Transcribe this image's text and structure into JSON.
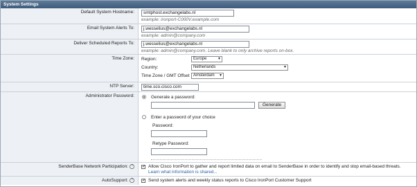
{
  "panel": {
    "title": "System Settings"
  },
  "hostname": {
    "label": "Default System Hostname:",
    "value": "smtphost.exchangelabs.nl",
    "hint": "example: ironport-C000V.example.com"
  },
  "alerts": {
    "label": "Email System Alerts To:",
    "value": "j.wesselius@exchangelabs.nl",
    "hint": "example: admin@company.com"
  },
  "reports": {
    "label": "Deliver Scheduled Reports To:",
    "value": "j.wesselius@exchangelabs.nl",
    "hint": "example: admin@company.com. Leave blank to only archive reports on-box."
  },
  "timezone": {
    "label": "Time Zone:",
    "region_label": "Region:",
    "region_value": "Europe",
    "country_label": "Country:",
    "country_value": "Netherlands",
    "offset_label": "Time Zone / GMT Offset",
    "offset_value": "Amsterdam"
  },
  "ntp": {
    "label": "NTP Server:",
    "value": "time.sco.cisco.com"
  },
  "admin_password": {
    "label": "Administrator Password:",
    "generate_label": "Generate a password:",
    "generate_button": "Generate",
    "choice_label": "Enter a password of your choice",
    "password_label": "Password:",
    "retype_label": "Retype Password:"
  },
  "senderbase": {
    "label": "SenderBase Network Participation:",
    "help_icon": "?",
    "text": "Allow Cisco IronPort to gather and report limited data on email to SenderBase in order to identify and stop email-based threats.",
    "link": "Learn what information is shared..."
  },
  "autosupport": {
    "label": "AutoSupport:",
    "help_icon": "?",
    "text": "Send system alerts and weekly status reports to Cisco IronPort Customer Support"
  }
}
